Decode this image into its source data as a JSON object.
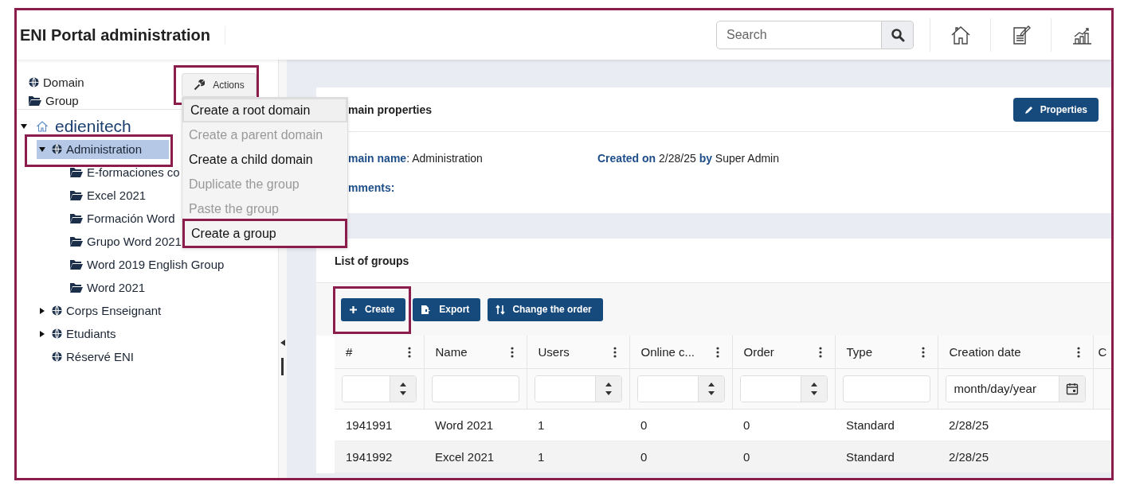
{
  "header": {
    "title": "ENI Portal administration",
    "search": {
      "placeholder": "Search"
    }
  },
  "sidebar": {
    "legend": [
      {
        "kind": "domain",
        "label": "Domain"
      },
      {
        "kind": "group",
        "label": "Group"
      }
    ],
    "actions_button": {
      "label": "Actions",
      "highlighted": true
    },
    "actions_menu": [
      {
        "label": "Create a root domain",
        "disabled": false,
        "focused": true
      },
      {
        "label": "Create a parent domain",
        "disabled": true,
        "focused": false
      },
      {
        "label": "Create a child domain",
        "disabled": false,
        "focused": false
      },
      {
        "label": "Duplicate the group",
        "disabled": true,
        "focused": false
      },
      {
        "label": "Paste the group",
        "disabled": true,
        "focused": false
      },
      {
        "label": "Create a group",
        "disabled": false,
        "focused": false,
        "highlighted": true
      }
    ],
    "tree": [
      {
        "kind": "root",
        "label": "edienitech",
        "expanded": true,
        "selected": false,
        "children": [
          {
            "kind": "domain",
            "label": "Administration",
            "expanded": true,
            "selected": true,
            "highlighted": true,
            "children": [
              {
                "kind": "group",
                "label": "E-formaciones co",
                "selected": false
              },
              {
                "kind": "group",
                "label": "Excel 2021",
                "selected": false
              },
              {
                "kind": "group",
                "label": "Formación Word",
                "selected": false
              },
              {
                "kind": "group",
                "label": "Grupo Word 2021",
                "selected": false
              },
              {
                "kind": "group",
                "label": "Word 2019 English Group",
                "selected": false
              },
              {
                "kind": "group",
                "label": "Word 2021",
                "selected": false
              }
            ]
          },
          {
            "kind": "domain",
            "label": "Corps Enseignant",
            "expanded": false,
            "selected": false
          },
          {
            "kind": "domain",
            "label": "Etudiants",
            "expanded": false,
            "selected": false
          },
          {
            "kind": "domain",
            "label": "Réservé ENI",
            "selected": false
          }
        ]
      }
    ]
  },
  "properties_card": {
    "title": "main properties",
    "button": "Properties",
    "name_line": "**main name**: Administration",
    "created_line": "**Created on** 2/28/25 **by** Super Admin",
    "comments_label": "mments:"
  },
  "groups_card": {
    "title": "List of groups",
    "toolbar": [
      {
        "kind": "create",
        "label": "Create",
        "highlighted": true
      },
      {
        "kind": "export",
        "label": "Export"
      },
      {
        "kind": "order",
        "label": "Change the order"
      }
    ],
    "columns": [
      {
        "label": "#",
        "kind": "number"
      },
      {
        "label": "Name",
        "kind": "text"
      },
      {
        "label": "Users",
        "kind": "number"
      },
      {
        "label": "Online c...",
        "kind": "number"
      },
      {
        "label": "Order",
        "kind": "number"
      },
      {
        "label": "Type",
        "kind": "text"
      },
      {
        "label": "Creation date",
        "kind": "date",
        "placeholder": "month/day/year"
      },
      {
        "label": "C",
        "kind": "cut"
      }
    ],
    "rows": [
      [
        "1941991",
        "Word 2021",
        "1",
        "0",
        "0",
        "Standard",
        "2/28/25"
      ],
      [
        "1941992",
        "Excel 2021",
        "1",
        "0",
        "0",
        "Standard",
        "2/28/25"
      ]
    ]
  }
}
